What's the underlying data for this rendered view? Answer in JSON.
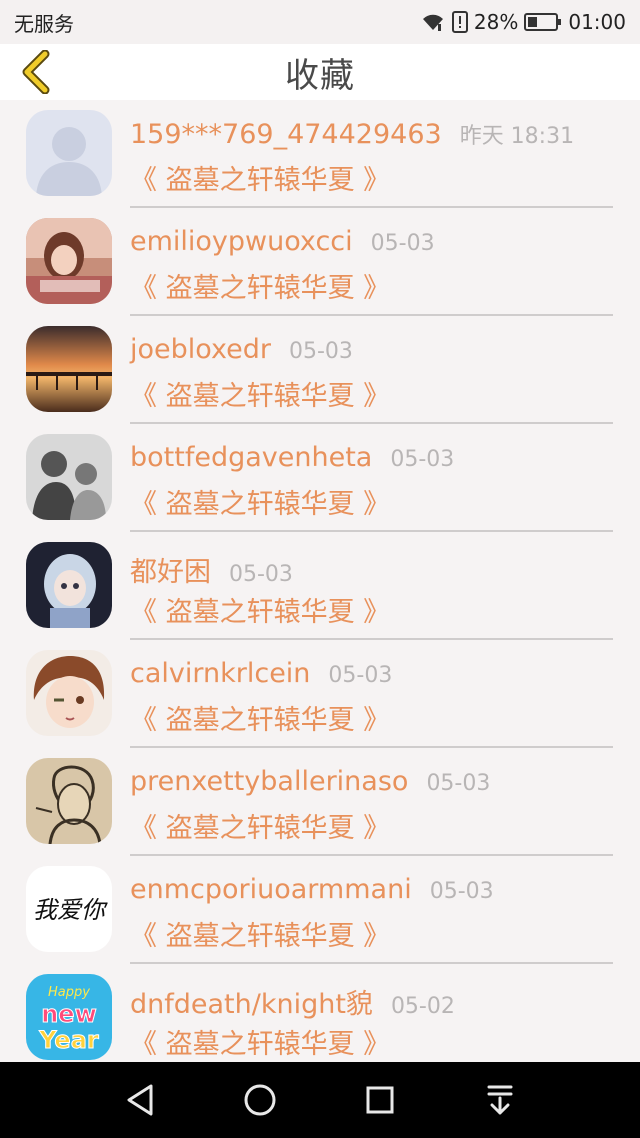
{
  "status_bar": {
    "carrier": "无服务",
    "battery_percent": "28%",
    "time": "01:00"
  },
  "header": {
    "title": "收藏"
  },
  "items": [
    {
      "name": "159***769_474429463",
      "time": "昨天 18:31",
      "novel": "《 盗墓之轩辕华夏 》",
      "avatar": "avatar-placeholder-icon"
    },
    {
      "name": "emilioypwuoxcci",
      "time": "05-03",
      "novel": "《 盗墓之轩辕华夏 》",
      "avatar": "girl-photo"
    },
    {
      "name": "joebloxedr",
      "time": "05-03",
      "novel": "《 盗墓之轩辕华夏 》",
      "avatar": "pier-sunset-photo"
    },
    {
      "name": "bottfedgavenheta",
      "time": "05-03",
      "novel": "《 盗墓之轩辕华夏 》",
      "avatar": "father-child-photo"
    },
    {
      "name": "都好困",
      "time": "05-03",
      "novel": "《 盗墓之轩辕华夏 》",
      "avatar": "anime-girl-image"
    },
    {
      "name": "calvirnkrlcein",
      "time": "05-03",
      "novel": "《 盗墓之轩辕华夏 》",
      "avatar": "anime-boy-image"
    },
    {
      "name": "prenxettyballerinaso",
      "time": "05-03",
      "novel": "《 盗墓之轩辕华夏 》",
      "avatar": "sketch-man-image"
    },
    {
      "name": "enmcporiuoarmmani",
      "time": "05-03",
      "novel": "《 盗墓之轩辕华夏 》",
      "avatar": "calligraphy-image",
      "avatar_text": "我爱你"
    },
    {
      "name": "dnfdeath/knight貌",
      "time": "05-02",
      "novel": "《 盗墓之轩辕华夏 》",
      "avatar": "happy-new-year-image",
      "avatar_text_top": "Happy",
      "avatar_text_mid": "new",
      "avatar_text_bot": "Year"
    }
  ],
  "colors": {
    "accent": "#e8915b",
    "time": "#b8b5b5",
    "back_arrow": "#e6c21a",
    "background": "#f6f3f3"
  }
}
